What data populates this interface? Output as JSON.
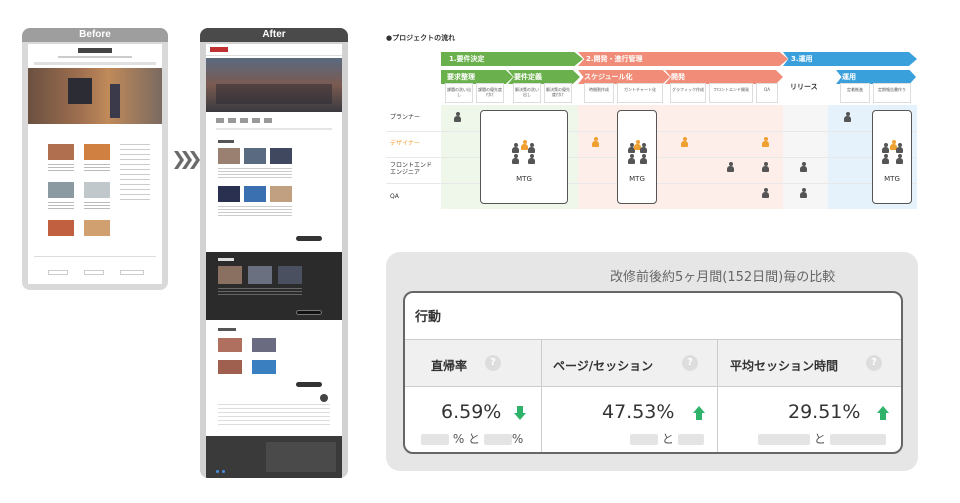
{
  "before_panel": {
    "label": "Before",
    "header_color": "#9e9e9e"
  },
  "after_panel": {
    "label": "After",
    "header_color": "#4a4a4a"
  },
  "flow": {
    "title": "●プロジェクトの流れ",
    "phases": [
      {
        "label": "1.要件決定",
        "color": "#6ab04c"
      },
      {
        "label": "2.開発・進行管理",
        "color": "#f08c77"
      },
      {
        "label": "3.運用",
        "color": "#3aa0dc"
      }
    ],
    "tasks": [
      {
        "label": "要求整理",
        "color": "#6ab04c"
      },
      {
        "label": "要件定義",
        "color": "#6ab04c"
      },
      {
        "label": "スケジュール化",
        "color": "#f08c77"
      },
      {
        "label": "開発",
        "color": "#f08c77"
      },
      {
        "label": "リリース",
        "color": "#ffffff"
      },
      {
        "label": "運用",
        "color": "#3aa0dc"
      }
    ],
    "subtasks": [
      "課題の洗い出し",
      "課題の優先度付け",
      "解決策の洗い出し",
      "解決策の優先度付け",
      "時間割作成",
      "ガントチャート化",
      "グラフィック作成",
      "フロントエンド開発",
      "QA",
      "定着推進",
      "定期報告書作り"
    ],
    "roles": [
      "プランナー",
      "デザイナー",
      "フロントエンド\nエンジニア",
      "QA"
    ],
    "meeting_label": "MTG",
    "colors": {
      "planner": "#555555",
      "designer": "#f0a030",
      "engineer": "#555555",
      "qa": "#555555"
    }
  },
  "stats": {
    "caption": "改修前後約5ヶ月間(152日間)毎の比較",
    "card_title": "行動",
    "help_icon": "?",
    "columns": [
      {
        "label": "直帰率",
        "value": "6.59%",
        "trend": "down",
        "compare_joiner": "% と",
        "compare_suffix": "%"
      },
      {
        "label": "ページ/セッション",
        "value": "47.53%",
        "trend": "up",
        "compare_joiner": "と",
        "compare_suffix": ""
      },
      {
        "label": "平均セッション時間",
        "value": "29.51%",
        "trend": "up",
        "compare_joiner": "と",
        "compare_suffix": ""
      }
    ],
    "trend_color": "#2fb36a"
  }
}
